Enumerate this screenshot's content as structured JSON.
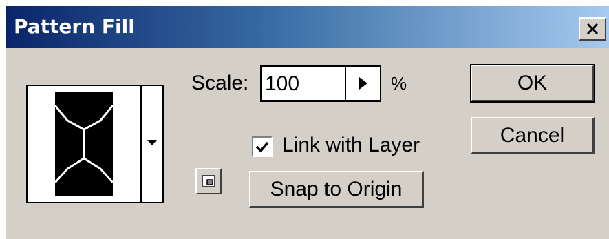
{
  "window": {
    "title": "Pattern Fill",
    "close_icon": "close-icon"
  },
  "pattern": {
    "swatch_icon": "pattern-swatch",
    "picker_icon": "dropdown-arrow-icon"
  },
  "scale": {
    "label": "Scale:",
    "value": "100",
    "unit": "%",
    "slider_icon": "triangle-right-icon"
  },
  "link_with_layer": {
    "label": "Link with Layer",
    "checked": true
  },
  "buttons": {
    "ok": "OK",
    "cancel": "Cancel",
    "snap_to_origin": "Snap to Origin",
    "new_preset_icon": "create-preset-icon"
  },
  "colors": {
    "dialog_bg": "#d4d0c8",
    "title_start": "#0a246a",
    "title_end": "#a6caf0"
  }
}
